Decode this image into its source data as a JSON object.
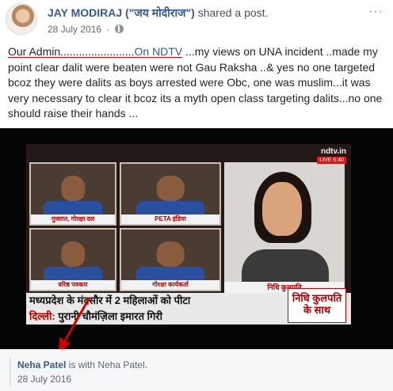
{
  "post": {
    "author_name": "JAY MODIRAJ (\"जय मोदीराज\")",
    "action": " shared a post.",
    "date": "28 July 2016",
    "separator": "·",
    "visibility_icon": "globe-icon",
    "more_icon": "ellipsis-icon",
    "more_label": "···",
    "text_lead": "Our Admin........................",
    "text_link": "On NDTV",
    "text_body": " ...my views on UNA incident ..made my point clear dalit were beaten were not Gau Raksha ..& yes no one targeted bcoz they were dalits as boys arrested were Obc, one was muslim...it was very necessary to clear it bcoz its a myth open class targeting dalits...no one should raise their hands ..."
  },
  "video": {
    "channel": "ndtv.in",
    "live_badge": "LIVE 6:40",
    "panels": [
      {
        "caption": "गुजरात, गोरक्षा दल"
      },
      {
        "caption": "PETA इंडिया"
      },
      {
        "caption": "वरिष्ठ पत्रकार"
      },
      {
        "caption": "गोरक्षा कार्यकर्ता"
      }
    ],
    "anchor_caption": "निधि कुलपति",
    "ticker_line1": "मध्यप्रदेश के मंदसौर में 2 महिलाओं को पीटा",
    "ticker_line2_city": "दिल्ली:",
    "ticker_line2_text": " पुरानी चौमंज़िला इमारत गिरी",
    "show_box": "निधि कुलपति के साथ"
  },
  "footer": {
    "shared_from": "Neha Patel",
    "with_text": " is with ",
    "with_name": "Neha Patel",
    "trailing": ".",
    "date": "28 July 2016"
  },
  "colors": {
    "link": "#365899",
    "annotation_red": "#d00000",
    "secondary_text": "#616770"
  }
}
